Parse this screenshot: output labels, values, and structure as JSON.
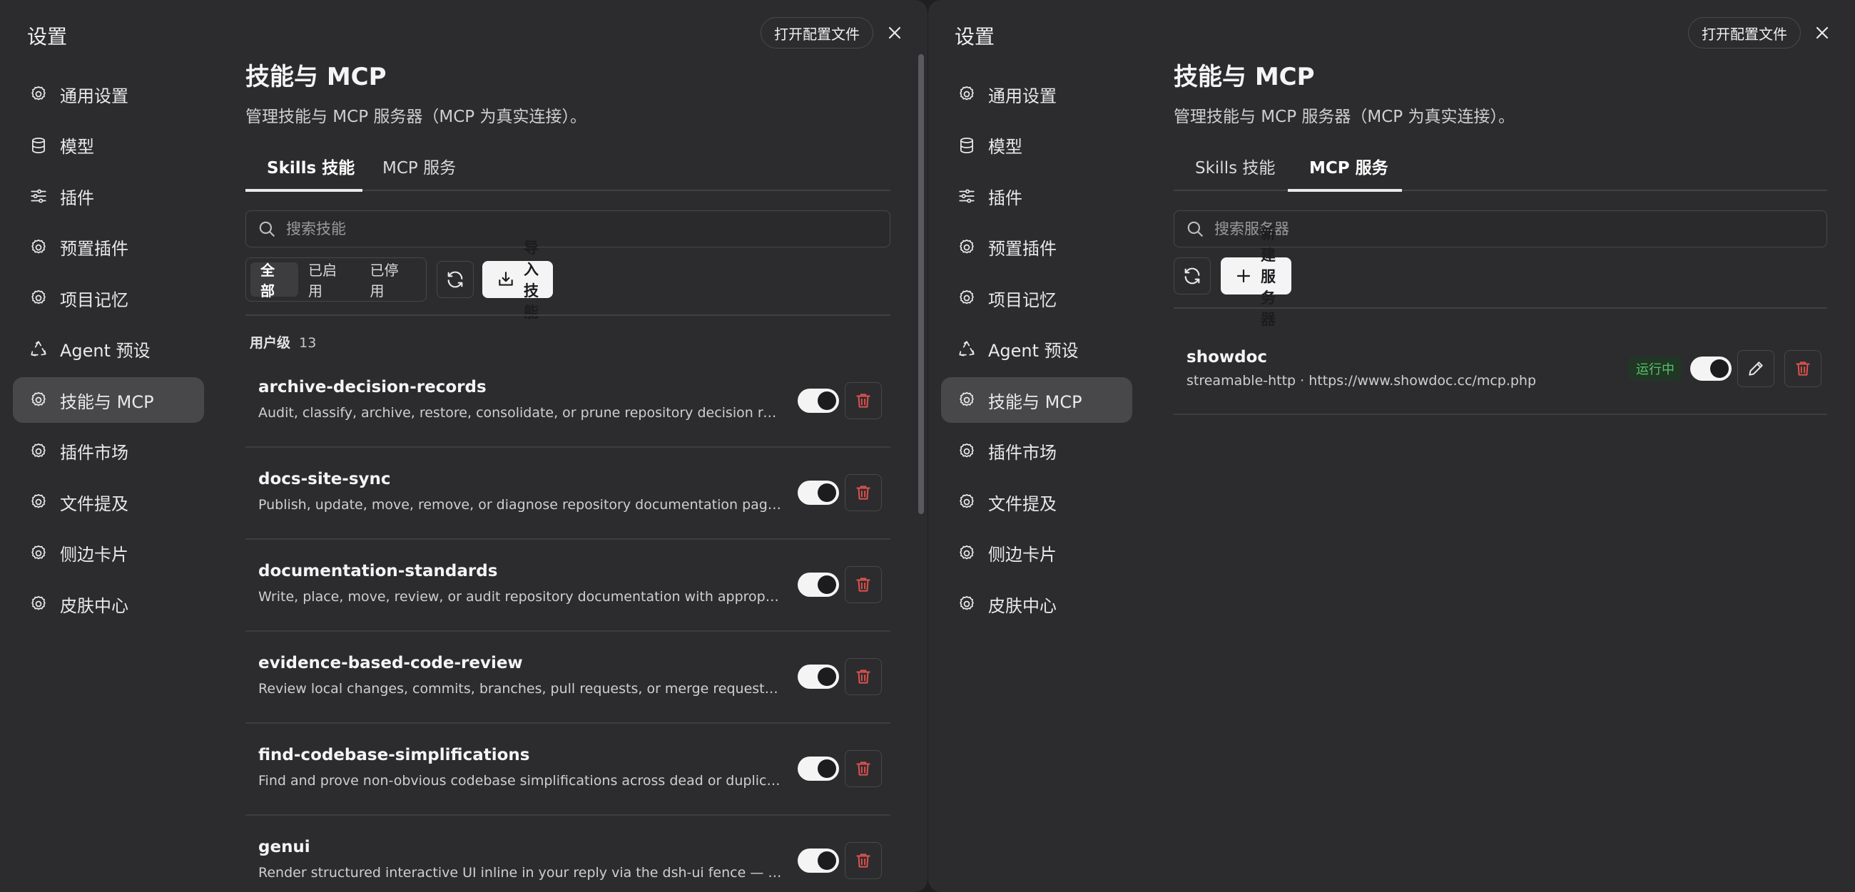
{
  "left": {
    "header": {
      "title": "设置",
      "open_config": "打开配置文件"
    },
    "sidebar": [
      {
        "label": "通用设置",
        "icon": "gear-icon"
      },
      {
        "label": "模型",
        "icon": "database-icon"
      },
      {
        "label": "插件",
        "icon": "sliders-icon"
      },
      {
        "label": "预置插件",
        "icon": "gear-icon"
      },
      {
        "label": "项目记忆",
        "icon": "gear-icon"
      },
      {
        "label": "Agent 预设",
        "icon": "recycle-icon"
      },
      {
        "label": "技能与 MCP",
        "icon": "gear-icon",
        "active": true
      },
      {
        "label": "插件市场",
        "icon": "gear-icon"
      },
      {
        "label": "文件提及",
        "icon": "gear-icon"
      },
      {
        "label": "侧边卡片",
        "icon": "gear-icon"
      },
      {
        "label": "皮肤中心",
        "icon": "gear-icon"
      }
    ],
    "main": {
      "title": "技能与 MCP",
      "subtitle": "管理技能与 MCP 服务器（MCP 为真实连接）。",
      "tabs": [
        {
          "label": "Skills 技能",
          "active": true
        },
        {
          "label": "MCP 服务",
          "active": false
        }
      ],
      "search_placeholder": "搜索技能",
      "filters": [
        {
          "label": "全部",
          "active": true
        },
        {
          "label": "已启用"
        },
        {
          "label": "已停用"
        }
      ],
      "import_label": "导入技能",
      "group_label": "用户级",
      "group_count": "13",
      "skills": [
        {
          "name": "archive-decision-records",
          "desc": "Audit, classify, archive, restore, consolidate, or prune repository decision records suc...",
          "enabled": true
        },
        {
          "name": "docs-site-sync",
          "desc": "Publish, update, move, remove, or diagnose repository documentation pages projec...",
          "enabled": true
        },
        {
          "name": "documentation-standards",
          "desc": "Write, place, move, review, or audit repository documentation with appropriate hiera...",
          "enabled": true
        },
        {
          "name": "evidence-based-code-review",
          "desc": "Review local changes, commits, branches, pull requests, or merge requests against t...",
          "enabled": true
        },
        {
          "name": "find-codebase-simplifications",
          "desc": "Find and prove non-obvious codebase simplifications across dead or duplicated beh...",
          "enabled": true
        },
        {
          "name": "genui",
          "desc": "Render structured interactive UI inline in your reply via the dsh-ui fence — not just c...",
          "enabled": true
        }
      ]
    }
  },
  "right": {
    "header": {
      "title": "设置",
      "open_config": "打开配置文件"
    },
    "main": {
      "title": "技能与 MCP",
      "subtitle": "管理技能与 MCP 服务器（MCP 为真实连接）。",
      "tabs": [
        {
          "label": "Skills 技能",
          "active": false
        },
        {
          "label": "MCP 服务",
          "active": true
        }
      ],
      "search_placeholder": "搜索服务器",
      "new_server_label": "新建服务器",
      "servers": [
        {
          "name": "showdoc",
          "detail": "streamable-http · https://www.showdoc.cc/mcp.php",
          "status": "运行中",
          "enabled": true
        }
      ]
    }
  },
  "colors": {
    "panel": "#2c2c2e",
    "active_item": "#48484b",
    "danger": "#e0524f",
    "running": "#58c26a"
  }
}
